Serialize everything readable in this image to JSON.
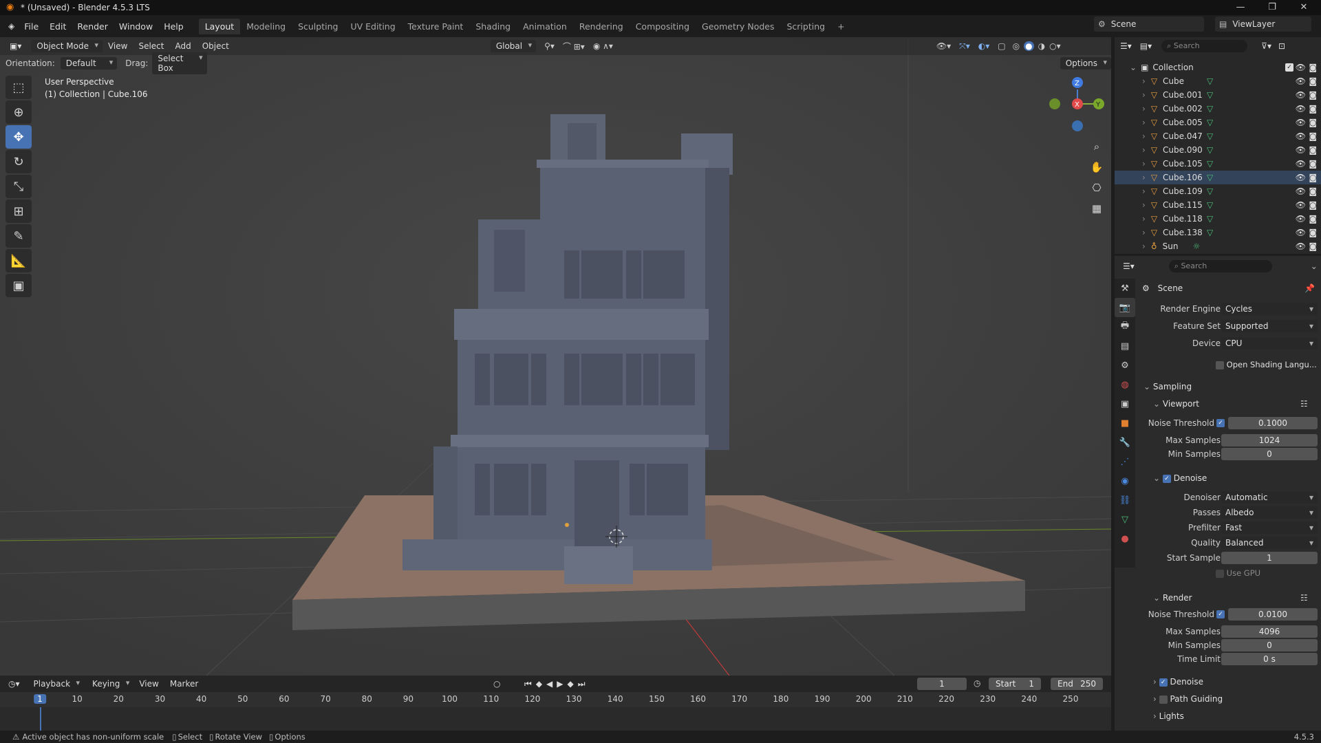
{
  "window": {
    "title": "* (Unsaved) - Blender 4.5.3 LTS",
    "controls": [
      "—",
      "❐",
      "✕"
    ]
  },
  "menu": [
    "File",
    "Edit",
    "Render",
    "Window",
    "Help"
  ],
  "workspaces": [
    "Layout",
    "Modeling",
    "Sculpting",
    "UV Editing",
    "Texture Paint",
    "Shading",
    "Animation",
    "Rendering",
    "Compositing",
    "Geometry Nodes",
    "Scripting"
  ],
  "active_workspace": "Layout",
  "scene_name": "Scene",
  "view_layer": "ViewLayer",
  "viewport_header": {
    "mode": "Object Mode",
    "menus": [
      "View",
      "Select",
      "Add",
      "Object"
    ],
    "transform": "Global",
    "options": "Options"
  },
  "viewport_header2": {
    "orientation_label": "Orientation:",
    "orientation": "Default",
    "drag_label": "Drag:",
    "drag": "Select Box"
  },
  "viewport_info": {
    "line1": "User Perspective",
    "line2": "(1) Collection | Cube.106"
  },
  "gizmo": {
    "x": "X",
    "y": "Y",
    "z": "Z"
  },
  "outliner": {
    "search_placeholder": "Search",
    "collection": "Collection",
    "items": [
      "Cube",
      "Cube.001",
      "Cube.002",
      "Cube.005",
      "Cube.047",
      "Cube.090",
      "Cube.105",
      "Cube.106",
      "Cube.109",
      "Cube.115",
      "Cube.118",
      "Cube.138",
      "Sun"
    ],
    "selected": "Cube.106"
  },
  "properties": {
    "search_placeholder": "Search",
    "context": "Scene",
    "render_engine_label": "Render Engine",
    "render_engine": "Cycles",
    "feature_set_label": "Feature Set",
    "feature_set": "Supported",
    "device_label": "Device",
    "device": "CPU",
    "osl_label": "Open Shading Langu...",
    "sampling": "Sampling",
    "viewport": "Viewport",
    "noise_threshold_label": "Noise Threshold",
    "vp_noise_threshold": "0.1000",
    "max_samples_label": "Max Samples",
    "vp_max_samples": "1024",
    "min_samples_label": "Min Samples",
    "vp_min_samples": "0",
    "denoise": "Denoise",
    "denoiser_label": "Denoiser",
    "denoiser": "Automatic",
    "passes_label": "Passes",
    "passes": "Albedo",
    "prefilter_label": "Prefilter",
    "prefilter": "Fast",
    "quality_label": "Quality",
    "quality": "Balanced",
    "start_sample_label": "Start Sample",
    "start_sample": "1",
    "use_gpu": "Use GPU",
    "render": "Render",
    "r_noise_threshold": "0.0100",
    "r_max_samples": "4096",
    "r_min_samples": "0",
    "time_limit_label": "Time Limit",
    "time_limit": "0 s",
    "denoise2": "Denoise",
    "path_guiding": "Path Guiding",
    "lights": "Lights"
  },
  "timeline": {
    "menus": [
      "Playback",
      "Keying",
      "View",
      "Marker"
    ],
    "current_frame": "1",
    "start_label": "Start",
    "start": "1",
    "end_label": "End",
    "end": "250",
    "ruler": [
      "1",
      "10",
      "20",
      "30",
      "40",
      "50",
      "60",
      "70",
      "80",
      "90",
      "100",
      "110",
      "120",
      "130",
      "140",
      "150",
      "160",
      "170",
      "180",
      "190",
      "200",
      "210",
      "220",
      "230",
      "240",
      "250"
    ]
  },
  "status": {
    "warning": "Active object has non-uniform scale",
    "select": "Select",
    "rotate": "Rotate View",
    "options": "Options",
    "version": "4.5.3"
  }
}
